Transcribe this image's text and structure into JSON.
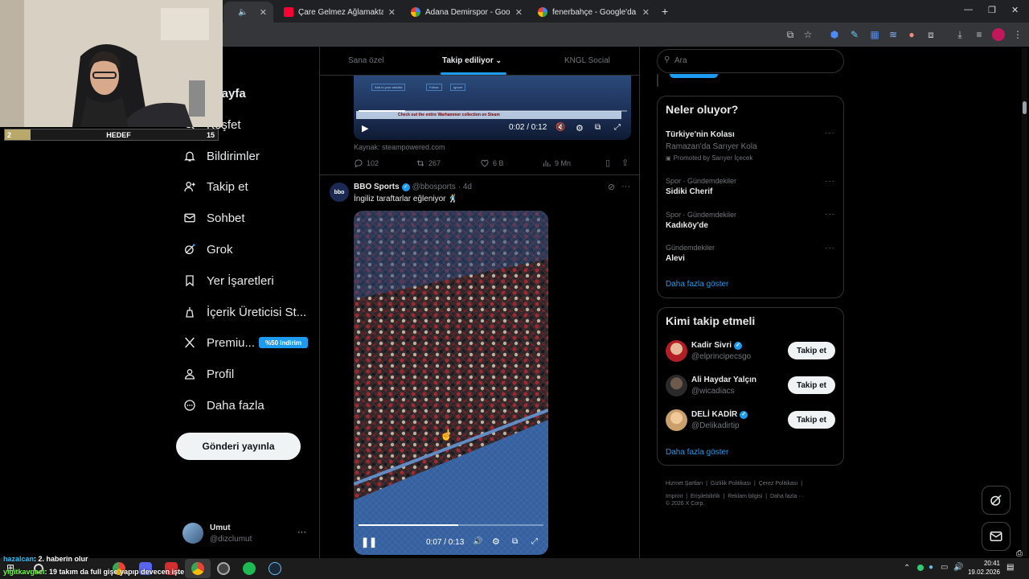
{
  "browser": {
    "tabs": [
      {
        "label": "Çare Gelmez Ağlamaktan BB Er",
        "favicon_color": "#ff0033"
      },
      {
        "label": "Adana Demirspor - Google'da A",
        "favicon_color": "#ffffff"
      },
      {
        "label": "fenerbahçe - Google'da Ara",
        "favicon_color": "#ffffff"
      }
    ],
    "new_tab": "+",
    "close_glyph": "✕",
    "window_controls": [
      "—",
      "❐",
      "✕"
    ]
  },
  "overlay": {
    "goal_count": "2",
    "goal_label": "HEDEF",
    "goal_target": "15"
  },
  "nav": {
    "items": [
      {
        "label": "Anasayfa",
        "partial": "asayfa",
        "icon": "home-icon"
      },
      {
        "label": "Keşfet",
        "partial": "Keşfet",
        "icon": "search-icon"
      },
      {
        "label": "Bildirimler",
        "icon": "bell-icon"
      },
      {
        "label": "Takip et",
        "icon": "person-add-icon"
      },
      {
        "label": "Sohbet",
        "icon": "mail-icon"
      },
      {
        "label": "Grok",
        "icon": "grok-icon"
      },
      {
        "label": "Yer İşaretleri",
        "icon": "bookmark-icon"
      },
      {
        "label": "İçerik Üreticisi St...",
        "icon": "creator-studio-icon"
      },
      {
        "label": "Premiu...",
        "icon": "x-logo-icon"
      },
      {
        "label": "Profil",
        "icon": "person-icon"
      },
      {
        "label": "Daha fazla",
        "icon": "more-circle-icon"
      }
    ],
    "premium_badge": "%50 indirim",
    "post_button": "Gönderi yayınla",
    "account": {
      "name": "Umut",
      "handle": "@dizclumut",
      "more": "···"
    }
  },
  "feed": {
    "tabs": [
      "Sana özel",
      "Takip ediliyor",
      "KNGL Social"
    ],
    "active_tab": "Takip ediliyor",
    "post1": {
      "video_time": "0:02 / 0:12",
      "video_caption": "Check out the entire Warhammer collection on Steam",
      "video_buttons": [
        "Add to your wishlist",
        "Follow",
        "Ignore"
      ],
      "source": "Kaynak: steampowered.com",
      "replies": "102",
      "reposts": "267",
      "likes": "6 B",
      "views": "9 Mn"
    },
    "post2": {
      "avatar_text": "bbo",
      "author": "BBO Sports",
      "handle": "@bbosports",
      "time": "· 4d",
      "text": "İngiliz taraftarlar eğleniyor 🕺",
      "video_time": "0:07 / 0:13",
      "progress": 0.54
    }
  },
  "right": {
    "search_placeholder": "Ara",
    "trends_title": "Neler oluyor?",
    "trends": [
      {
        "category": "",
        "name": "Türkiye'nin Kolası",
        "subtitle": "Ramazan'da Sarıyer Kola",
        "promoted": "Promoted by Sarıyer İçecek"
      },
      {
        "category": "Spor · Gündemdekiler",
        "name": "Sidiki Cherif"
      },
      {
        "category": "Spor · Gündemdekiler",
        "name": "Kadıköy'de"
      },
      {
        "category": "Gündemdekiler",
        "name": "Alevi"
      }
    ],
    "trends_more": "Daha fazla göster",
    "who_title": "Kimi takip etmeli",
    "who": [
      {
        "name": "Kadir Sivri",
        "handle": "@elprincipecsgo",
        "verified": true,
        "button": "Takip et"
      },
      {
        "name": "Ali Haydar Yalçın",
        "handle": "@wicadiacs",
        "verified": false,
        "button": "Takip et"
      },
      {
        "name": "DELİ KADİR",
        "handle": "@Delikadirtip",
        "verified": true,
        "button": "Takip et"
      }
    ],
    "who_more": "Daha fazla göster",
    "footer": [
      "Hizmet Şartları",
      "Gizlilik Politikası",
      "Çerez Politikası",
      "Imprint",
      "Erişilebilirlik",
      "Reklam bilgisi",
      "Daha fazla ···"
    ],
    "copyright": "© 2026 X Corp."
  },
  "chat": [
    {
      "user": "hazalcan",
      "text": ": 2. haberin olur",
      "color": "#22c0ff"
    },
    {
      "user": "yigitkavgaci",
      "text": ": 19 takım da full gişe yapıp devecen işte",
      "color": "#6cff3a"
    }
  ],
  "taskbar": {
    "time": "20:41",
    "date": "19.02.2026"
  }
}
